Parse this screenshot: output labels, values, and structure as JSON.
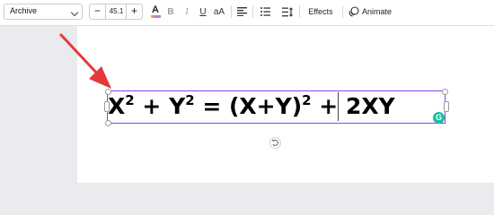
{
  "toolbar": {
    "font_family": "Archive",
    "font_size": "45.1",
    "minus_label": "−",
    "plus_label": "+",
    "text_color_label": "A",
    "text_color_underline": "#d86bd1",
    "bold_label": "B",
    "italic_label": "I",
    "underline_label": "U",
    "case_label": "aA",
    "effects_label": "Effects",
    "animate_label": "Animate"
  },
  "canvas": {
    "equation": {
      "base1": "X",
      "exp1": "2",
      "mid1": " + Y",
      "exp2": "2",
      "mid2": " = (X+Y)",
      "exp3": "2",
      "tail": " + 2XY"
    },
    "selection_color": "#8b3dff",
    "grammarly_label": "G",
    "grammarly_color": "#15c39a",
    "arrow_color": "#e5383b"
  }
}
